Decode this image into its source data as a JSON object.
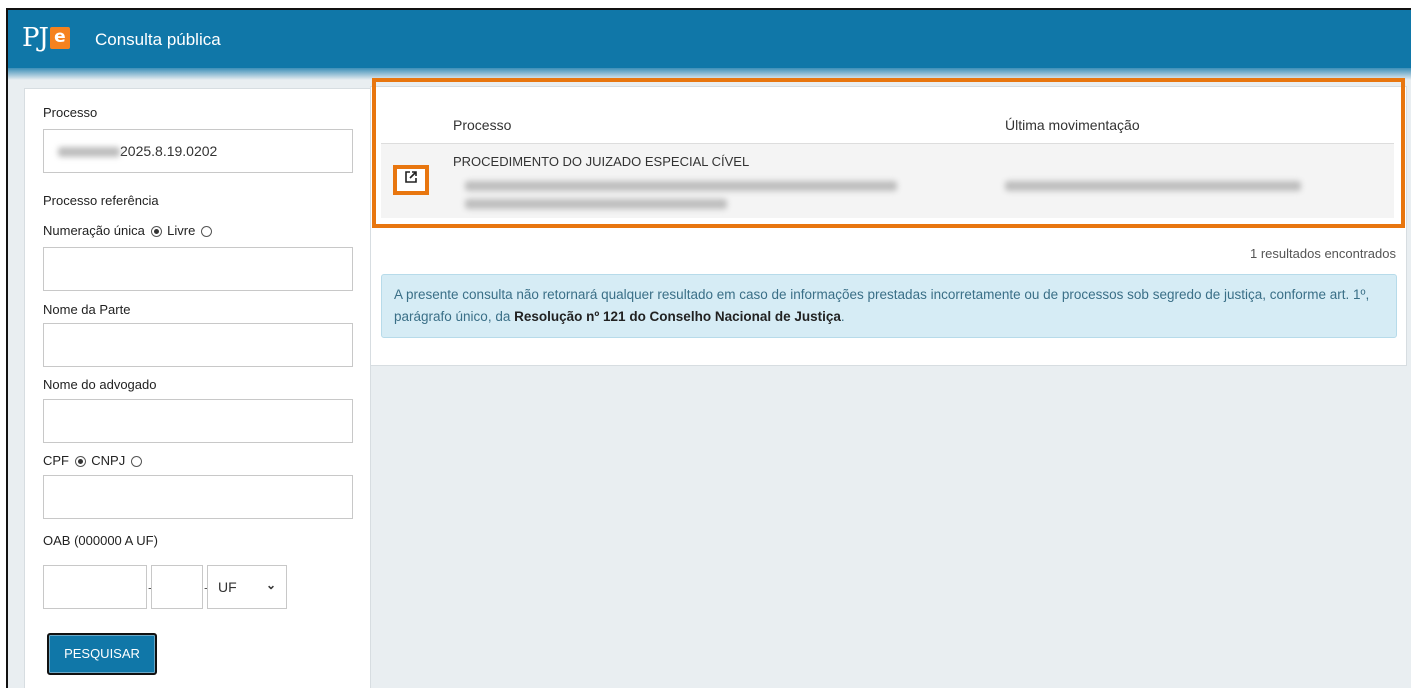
{
  "header": {
    "logo_text": "PJe",
    "title": "Consulta pública"
  },
  "form": {
    "processo_label": "Processo",
    "processo_value": "2025.8.19.0202",
    "processo_ref_label": "Processo referência",
    "numeracao_unica_label": "Numeração única",
    "livre_label": "Livre",
    "nome_parte_label": "Nome da Parte",
    "nome_advogado_label": "Nome do advogado",
    "cpf_label": "CPF",
    "cnpj_label": "CNPJ",
    "oab_label": "OAB (000000 A UF)",
    "oab_dash": "-",
    "uf_select": "UF",
    "search_button": "PESQUISAR"
  },
  "results": {
    "col_processo": "Processo",
    "col_ultima": "Última movimentação",
    "rows": [
      {
        "classe": "PROCEDIMENTO DO JUIZADO ESPECIAL CÍVEL"
      }
    ],
    "count_text": "1 resultados encontrados",
    "notice_text": "A presente consulta não retornará qualquer resultado em caso de informações prestadas incorretamente ou de processos sob segredo de justiça, conforme art. 1º, parágrafo único, da ",
    "notice_bold": "Resolução nº 121 do Conselho Nacional de Justiça",
    "notice_end": "."
  },
  "colors": {
    "brand_blue": "#1077a8",
    "accent_orange": "#e8760f",
    "notice_bg": "#d6ecf5"
  }
}
